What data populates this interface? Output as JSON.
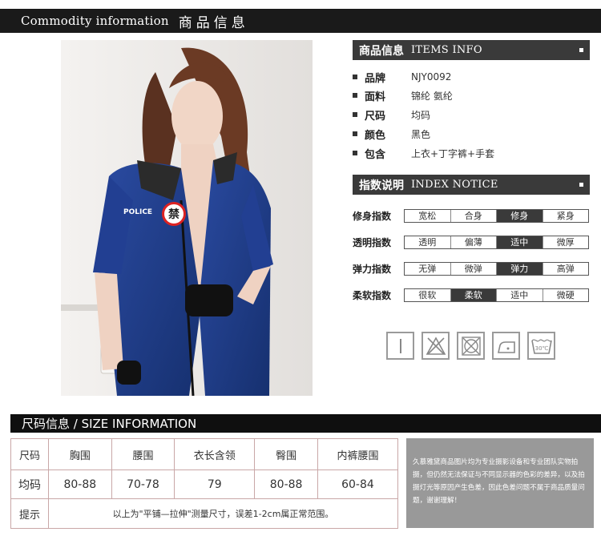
{
  "header": {
    "title_en": "Commodity information",
    "title_cn": "商品信息"
  },
  "items_info": {
    "title_cn": "商品信息",
    "title_en": "ITEMS INFO",
    "rows": [
      {
        "key": "品牌",
        "value": "NJY0092"
      },
      {
        "key": "面料",
        "value": "锦纶 氨纶"
      },
      {
        "key": "尺码",
        "value": "均码"
      },
      {
        "key": "颜色",
        "value": "黑色"
      },
      {
        "key": "包含",
        "value": "上衣+丁字裤+手套"
      }
    ]
  },
  "index_notice": {
    "title_cn": "指数说明",
    "title_en": "INDEX NOTICE",
    "rows": [
      {
        "label": "修身指数",
        "options": [
          "宽松",
          "合身",
          "修身",
          "紧身"
        ],
        "selected": 2
      },
      {
        "label": "透明指数",
        "options": [
          "透明",
          "偏薄",
          "适中",
          "微厚"
        ],
        "selected": 2
      },
      {
        "label": "弹力指数",
        "options": [
          "无弹",
          "微弹",
          "弹力",
          "高弹"
        ],
        "selected": 2
      },
      {
        "label": "柔软指数",
        "options": [
          "很软",
          "柔软",
          "适中",
          "微硬"
        ],
        "selected": 1
      }
    ]
  },
  "care_icons": [
    "hand-wash-line-icon",
    "no-bleach-icon",
    "no-tumble-dry-icon",
    "iron-icon",
    "wash-30c-icon"
  ],
  "care_text": {
    "wash_temp": "30℃"
  },
  "photo": {
    "badge_text": "禁",
    "patch_text": "POLICE"
  },
  "size_info": {
    "title": "尺码信息 / SIZE INFORMATION",
    "headers": [
      "尺码",
      "胸围",
      "腰围",
      "衣长含领",
      "臀围",
      "内裤腰围"
    ],
    "values": [
      "均码",
      "80-88",
      "70-78",
      "79",
      "80-88",
      "60-84"
    ],
    "note_label": "提示",
    "note_text": "以上为\"平铺—拉伸\"测量尺寸，误差1-2cm属正常范围。"
  },
  "disclaimer": "久慕雅黛商品图片均为专业摄影设备和专业团队实物拍摄，但仍然无法保证与不同显示器的色彩的差异，以及拍摄灯光等原因产生色差，因此色差问题不属于商品质量问题，谢谢理解！",
  "colors": {
    "dark_bar": "#3a3a3a",
    "black_bar": "#0f0f0f",
    "table_border": "#c9a7a7",
    "disclaimer_bg": "#999999",
    "dress_blue": "#1f3d8c"
  }
}
